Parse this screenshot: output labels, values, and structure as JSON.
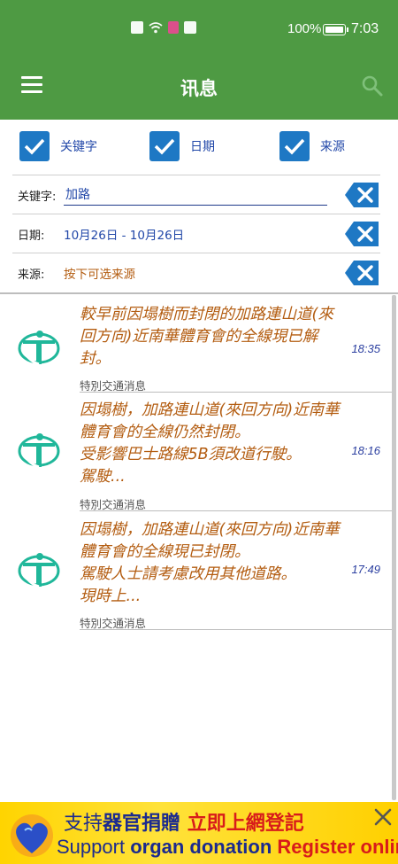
{
  "status_bar": {
    "battery": "100%",
    "clock": "7:03"
  },
  "header": {
    "title": "讯息",
    "menu_icon": "hamburger-menu-icon",
    "search_icon": "search-icon"
  },
  "filters": {
    "checkboxes": [
      {
        "label": "关键字",
        "checked": true
      },
      {
        "label": "日期",
        "checked": true
      },
      {
        "label": "来源",
        "checked": true
      }
    ],
    "keyword": {
      "label": "关键字:",
      "value": "加路"
    },
    "date": {
      "label": "日期:",
      "value": "10月26日 - 10月26日"
    },
    "source": {
      "label": "来源:",
      "value": "按下可选来源"
    }
  },
  "messages": [
    {
      "text": "較早前因塌樹而封閉的加路連山道(來回方向)近南華體育會的全線現已解封。",
      "time": "18:35",
      "source": "特別交通消息"
    },
    {
      "text": "因塌樹，加路連山道(來回方向)近南華體育會的全線仍然封閉。\n受影響巴士路線5B須改道行駛。\n駕駛...",
      "time": "18:16",
      "source": "特別交通消息"
    },
    {
      "text": "因塌樹，加路連山道(來回方向)近南華體育會的全線現已封閉。\n駕駛人士請考慮改用其他道路。\n現時上...",
      "time": "17:49",
      "source": "特別交通消息"
    }
  ],
  "banner": {
    "zh_prefix": "支持",
    "zh_main": "器官捐贈",
    "zh_red": "立即上網登記",
    "en_thin": "Support",
    "en_main": "organ donation",
    "en_red": "Register online!"
  },
  "colors": {
    "header": "#4e9a43",
    "checkbox": "#1e78c4",
    "message_text": "#b35c10",
    "time_text": "#2b3fa0",
    "banner": "#ffd400"
  }
}
